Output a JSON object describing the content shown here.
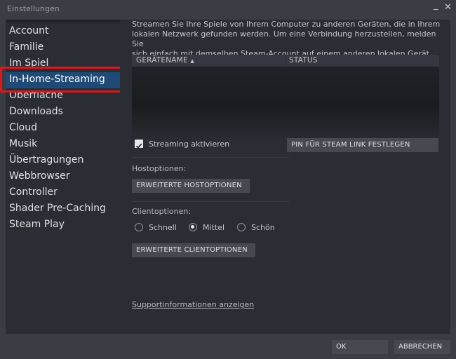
{
  "window": {
    "title": "Einstellungen",
    "minimize_glyph": "_",
    "close_glyph": "✕"
  },
  "sidebar": {
    "items": [
      {
        "label": "Account"
      },
      {
        "label": "Familie"
      },
      {
        "label": "Im Spiel"
      },
      {
        "label": "In-Home-Streaming",
        "active": true
      },
      {
        "label": "Oberfläche"
      },
      {
        "label": "Downloads"
      },
      {
        "label": "Cloud"
      },
      {
        "label": "Musik"
      },
      {
        "label": "Übertragungen"
      },
      {
        "label": "Webbrowser"
      },
      {
        "label": "Controller"
      },
      {
        "label": "Shader Pre-Caching"
      },
      {
        "label": "Steam Play"
      }
    ]
  },
  "main": {
    "description_lines": [
      "Streamen Sie Ihre Spiele von Ihrem Computer zu anderen Geräten, die in Ihrem",
      "lokalen Netzwerk gefunden werden. Um eine Verbindung herzustellen, melden Sie",
      "sich einfach mit demselben Steam-Account auf einem anderen lokalen Gerät an."
    ],
    "device_table": {
      "columns": [
        "GERÄTENAME",
        "STATUS"
      ],
      "sort_indicator": "▲",
      "rows": []
    },
    "streaming_checkbox": {
      "label": "Streaming aktivieren",
      "checked": true
    },
    "pin_button": "PIN FÜR STEAM LINK FESTLEGEN",
    "host_options": {
      "label": "Hostoptionen:",
      "button": "ERWEITERTE HOSTOPTIONEN"
    },
    "client_options": {
      "label": "Clientoptionen:",
      "radios": [
        {
          "label": "Schnell",
          "checked": false
        },
        {
          "label": "Mittel",
          "checked": true
        },
        {
          "label": "Schön",
          "checked": false
        }
      ],
      "button": "ERWEITERTE CLIENTOPTIONEN"
    },
    "support_link": "Supportinformationen anzeigen"
  },
  "footer": {
    "ok": "OK",
    "cancel": "ABBRECHEN"
  },
  "colors": {
    "active_item": "#1f4a75",
    "highlight_border": "#e4141b",
    "background": "#3a3d44",
    "panel": "#2a2d33"
  }
}
